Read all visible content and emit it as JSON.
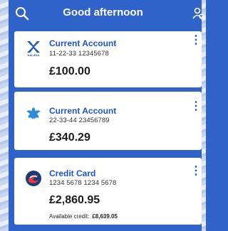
{
  "header": {
    "greeting": "Good afternoon",
    "search_icon": "search-icon",
    "profile_icon": "profile-icon"
  },
  "accounts": [
    {
      "name": "Current Account",
      "number": "11-22-33  12345678",
      "balance": "£100.00",
      "logo_icon": "halifax-logo",
      "logo_text": "HALIFAX"
    },
    {
      "name": "Current Account",
      "number": "22-33-44  23456789",
      "balance": "£340.29",
      "logo_icon": "eagle-logo"
    },
    {
      "name": "Credit Card",
      "number": "1234 5678 1234 5678",
      "balance": "£2,860.95",
      "available_label": "Available credit:",
      "available_value": "£8,639.05",
      "logo_icon": "swirl-logo"
    }
  ],
  "colors": {
    "brand": "#2f63c9",
    "accent": "#1b56c4"
  }
}
